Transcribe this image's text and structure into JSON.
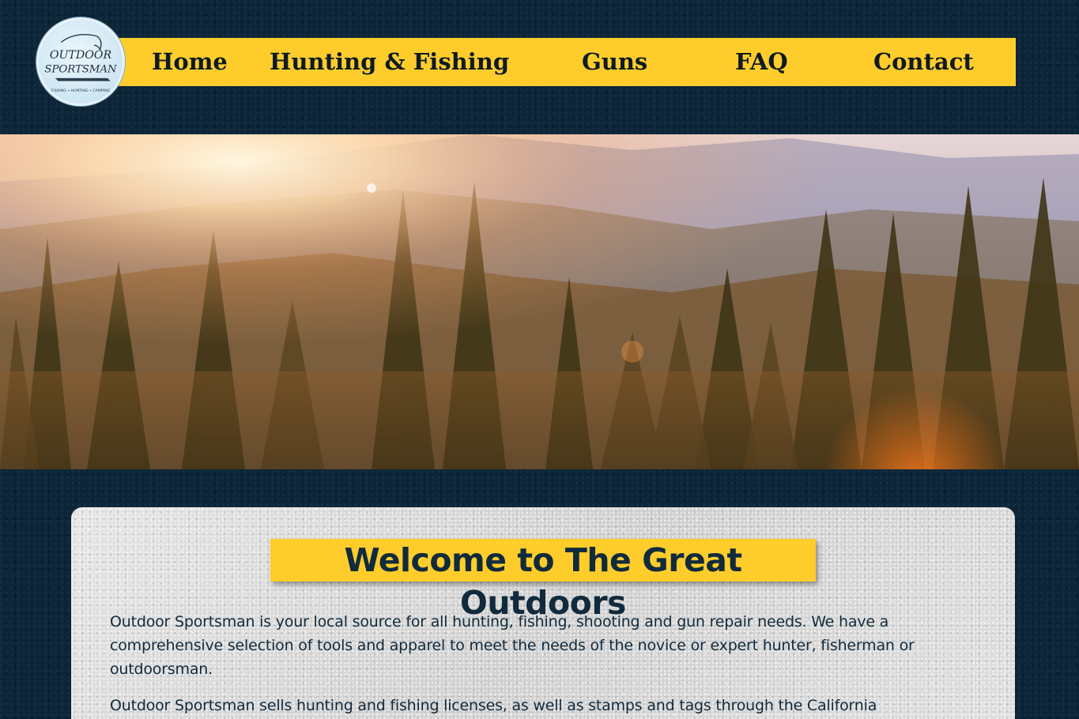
{
  "brand": {
    "logo_text_line1": "OUTDOOR",
    "logo_text_line2": "SPORTSMAN",
    "logo_tagline": "FISHING • HUNTING • CAMPING"
  },
  "nav": {
    "items": [
      {
        "label": "Home"
      },
      {
        "label": "Hunting & Fishing"
      },
      {
        "label": "Guns"
      },
      {
        "label": "FAQ"
      },
      {
        "label": "Contact"
      }
    ]
  },
  "main": {
    "welcome_title": "Welcome to The Great Outdoors",
    "paragraphs": [
      "Outdoor Sportsman is your local source for all hunting, fishing, shooting and gun repair needs. We have a comprehensive selection of tools and apparel to meet the needs of the novice or expert hunter, fisherman or outdoorsman.",
      "Outdoor Sportsman sells hunting and fishing licenses, as well as stamps and tags through the California"
    ]
  },
  "colors": {
    "background": "#0c2538",
    "nav_accent": "#fecd2c",
    "text_dark": "#112a3c"
  }
}
